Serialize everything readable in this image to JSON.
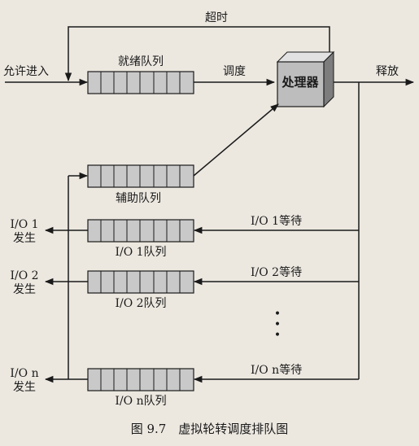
{
  "diagram": {
    "timeout_label": "超时",
    "admit_label": "允许进入",
    "ready_queue_label": "就绪队列",
    "dispatch_label": "调度",
    "processor_label": "处理器",
    "release_label": "释放",
    "aux_queue_label": "辅助队列",
    "io_events": [
      {
        "occurs_label": "I/O 1\n发生",
        "wait_label": "I/O 1等待",
        "queue_label": "I/O 1队列"
      },
      {
        "occurs_label": "I/O 2\n发生",
        "wait_label": "I/O 2等待",
        "queue_label": "I/O 2队列"
      },
      {
        "occurs_label": "I/O n\n发生",
        "wait_label": "I/O n等待",
        "queue_label": "I/O n队列"
      }
    ],
    "ellipsis": "•\n•\n•",
    "caption": "图 9.7　虚拟轮转调度排队图"
  },
  "colors": {
    "ink": "#1a1a1a",
    "queue_fill": "#c9c9c9",
    "processor_front": "#bdbdbd",
    "processor_top": "#e2e2e2",
    "processor_side": "#7d7d7d"
  }
}
